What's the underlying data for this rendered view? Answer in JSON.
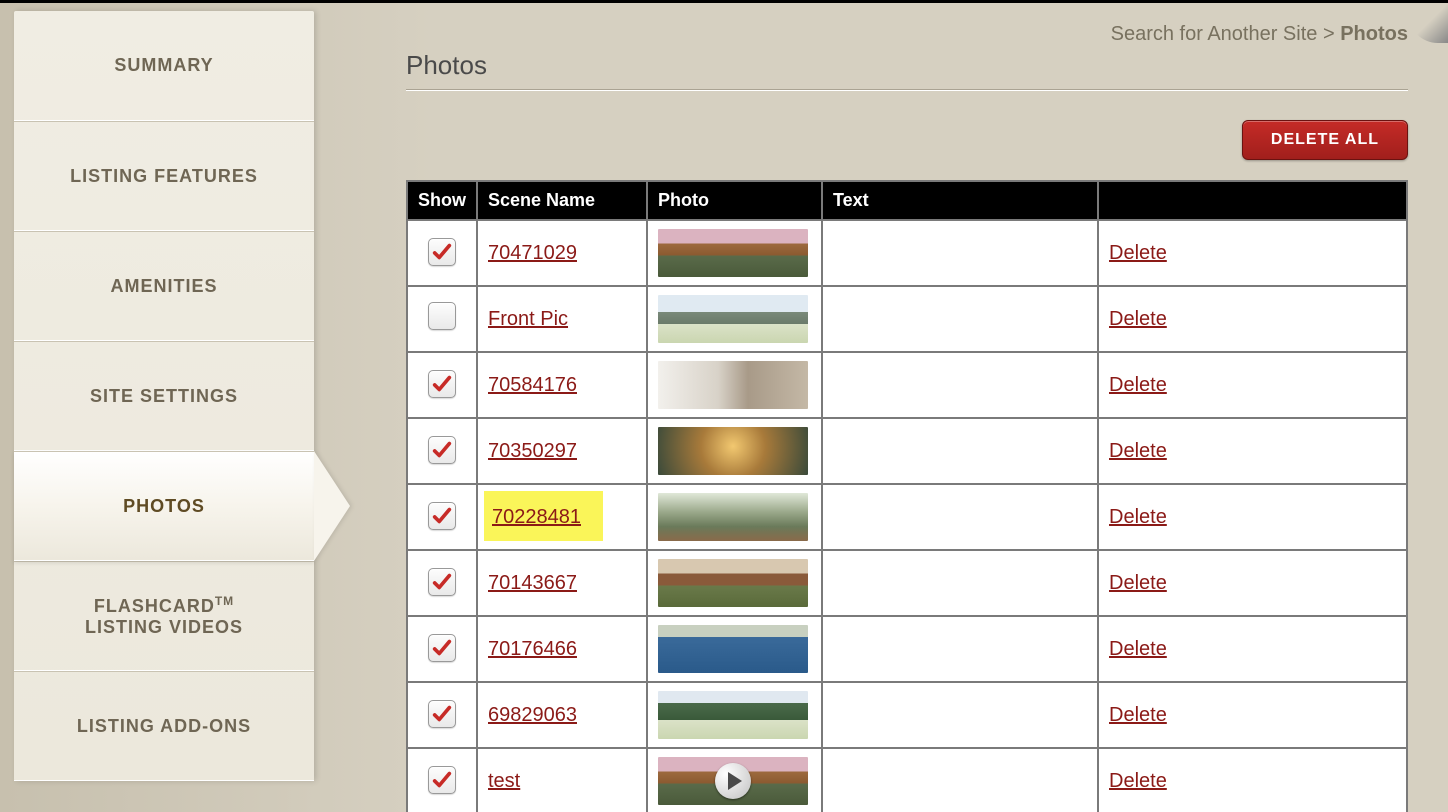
{
  "sidebar": {
    "items": [
      {
        "label": "SUMMARY"
      },
      {
        "label": "LISTING FEATURES"
      },
      {
        "label": "AMENITIES"
      },
      {
        "label": "SITE SETTINGS"
      },
      {
        "label": "PHOTOS"
      },
      {
        "label_pre": "FLASHCARD",
        "label_sup": "TM",
        "label_post": "LISTING VIDEOS"
      },
      {
        "label": "LISTING ADD-ONS"
      }
    ],
    "active_index": 4
  },
  "breadcrumb": {
    "link": "Search for Another Site",
    "sep": ">",
    "current": "Photos"
  },
  "page_title": "Photos",
  "buttons": {
    "delete_all": "DELETE ALL"
  },
  "table": {
    "headers": {
      "show": "Show",
      "scene": "Scene Name",
      "photo": "Photo",
      "text": "Text",
      "actions": ""
    },
    "delete_label": "Delete",
    "rows": [
      {
        "checked": true,
        "scene": "70471029",
        "thumb": "house1",
        "text": "",
        "highlight": false,
        "video": false
      },
      {
        "checked": false,
        "scene": "Front Pic",
        "thumb": "house2",
        "text": "",
        "highlight": false,
        "video": false
      },
      {
        "checked": true,
        "scene": "70584176",
        "thumb": "interior",
        "text": "",
        "highlight": false,
        "video": false
      },
      {
        "checked": true,
        "scene": "70350297",
        "thumb": "tree",
        "text": "",
        "highlight": false,
        "video": false
      },
      {
        "checked": true,
        "scene": "70228481",
        "thumb": "patio",
        "text": "",
        "highlight": true,
        "video": false
      },
      {
        "checked": true,
        "scene": "70143667",
        "thumb": "ranch",
        "text": "",
        "highlight": false,
        "video": false
      },
      {
        "checked": true,
        "scene": "70176466",
        "thumb": "pool",
        "text": "",
        "highlight": false,
        "video": false
      },
      {
        "checked": true,
        "scene": "69829063",
        "thumb": "trees2",
        "text": "",
        "highlight": false,
        "video": false
      },
      {
        "checked": true,
        "scene": "test",
        "thumb": "house1",
        "text": "",
        "highlight": false,
        "video": true
      }
    ]
  }
}
